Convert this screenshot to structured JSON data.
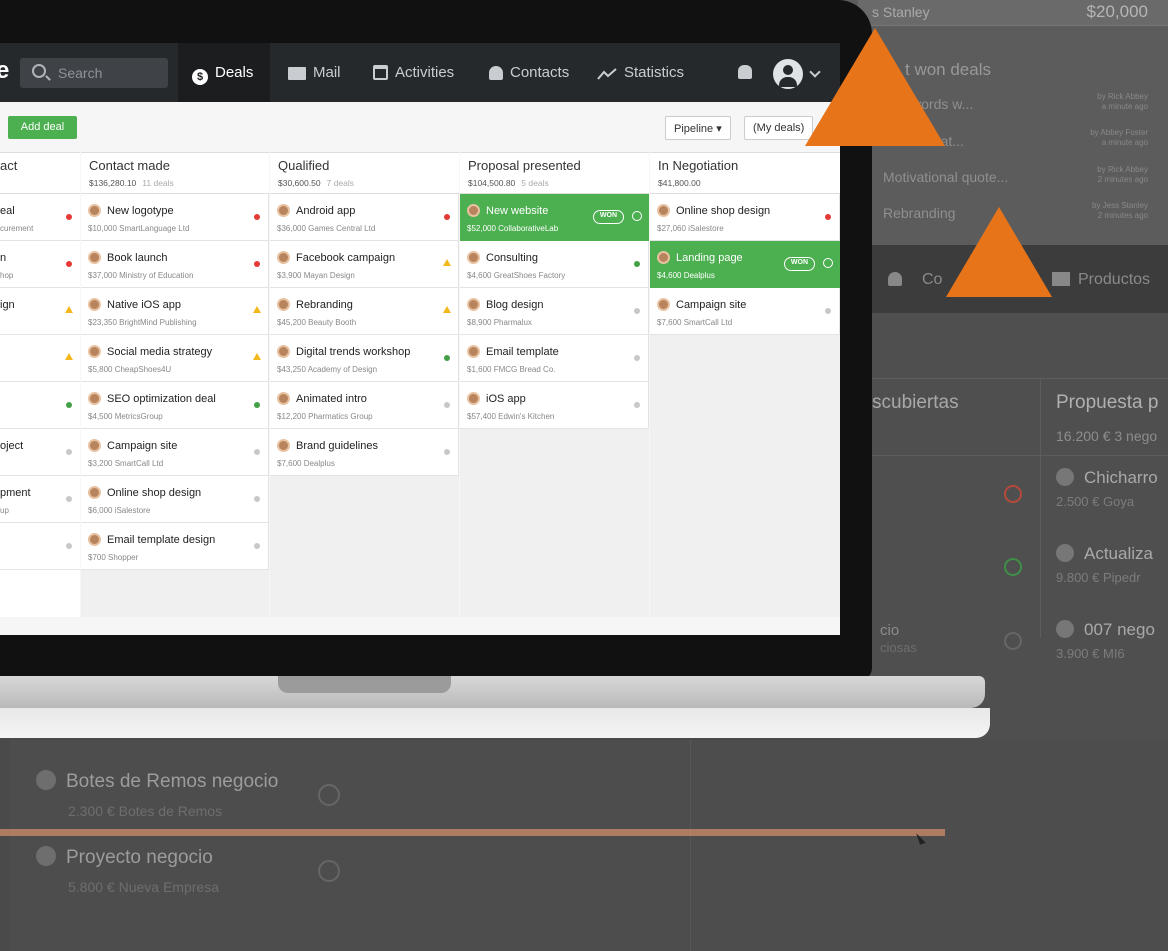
{
  "background": {
    "top_row": {
      "name": "s Stanley",
      "value": "$20,000"
    },
    "won_title": "t won deals",
    "won_items": [
      {
        "label": "e Adwords w...",
        "meta1": "by Rick Abbey",
        "meta2": "a minute ago"
      },
      {
        "label": "aunch strat...",
        "meta1": "by Abbey Foster",
        "meta2": "a minute ago"
      },
      {
        "label": "Motivational quote...",
        "meta1": "by Rick Abbey",
        "meta2": "2 minutes ago"
      },
      {
        "label": "Rebranding",
        "meta1": "by Jess Stanley",
        "meta2": "2 minutes ago"
      }
    ],
    "nav": {
      "contacts": "Co",
      "products": "Productos"
    },
    "stage_a": "scubiertas",
    "stage_b": {
      "title": "Propuesta p",
      "sub": "16.200 € 3 nego"
    },
    "cards": [
      {
        "title": "Chicharro",
        "sub": "2.500 €  Goya"
      },
      {
        "title": "Actualiza",
        "sub": "9.800 €  Pipedr"
      },
      {
        "title": "007 nego",
        "sub": "3.900 €  MI6"
      }
    ],
    "left_items": [
      {
        "title": "cio",
        "sub": "ciosas"
      }
    ],
    "bottom_items": [
      {
        "title": "Botes de Remos negocio",
        "sub": "2.300 €  Botes de Remos"
      },
      {
        "title": "Proyecto negocio",
        "sub": "5.800 €  Nueva Empresa"
      }
    ],
    "colors": {
      "orange": "#e8741a"
    }
  },
  "app": {
    "logo": "e",
    "search_placeholder": "Search",
    "nav": [
      {
        "label": "Deals",
        "icon": "dollar-icon",
        "active": true
      },
      {
        "label": "Mail",
        "icon": "mail-icon"
      },
      {
        "label": "Activities",
        "icon": "calendar-icon"
      },
      {
        "label": "Contacts",
        "icon": "person-icon"
      },
      {
        "label": "Statistics",
        "icon": "trend-icon"
      }
    ],
    "toolbar": {
      "add_deal": "Add deal",
      "pipeline": "Pipeline ▾",
      "filter": "(My deals)"
    },
    "left_stage": {
      "title": "act",
      "items": [
        {
          "t": "eal",
          "s": "curement"
        },
        {
          "t": "n",
          "s": "hop"
        },
        {
          "t": "ign",
          "s": ""
        },
        {
          "t": "",
          "s": ""
        },
        {
          "t": "",
          "s": ""
        },
        {
          "t": "oject",
          "s": ""
        },
        {
          "t": "pment",
          "s": "up"
        },
        {
          "t": "",
          "s": ""
        }
      ]
    },
    "stages": [
      {
        "title": "Contact made",
        "amount": "$136,280.10",
        "count": "11 deals",
        "deals": [
          {
            "title": "New logotype",
            "sub": "$10,000  SmartLanguage Ltd",
            "status": "red"
          },
          {
            "title": "Book launch",
            "sub": "$37,000  Ministry of Education",
            "status": "red"
          },
          {
            "title": "Native iOS app",
            "sub": "$23,350  BrightMind Publishing",
            "status": "yellow"
          },
          {
            "title": "Social media strategy",
            "sub": "$5,800  CheapShoes4U",
            "status": "yellow"
          },
          {
            "title": "SEO optimization deal",
            "sub": "$4,500  MetricsGroup",
            "status": "green"
          },
          {
            "title": "Campaign site",
            "sub": "$3,200  SmartCall Ltd",
            "status": "gray"
          },
          {
            "title": "Online shop design",
            "sub": "$6,000  iSalestore",
            "status": "gray"
          },
          {
            "title": "Email template design",
            "sub": "$700  Shopper",
            "status": "gray"
          }
        ]
      },
      {
        "title": "Qualified",
        "amount": "$30,600.50",
        "count": "7 deals",
        "deals": [
          {
            "title": "Android app",
            "sub": "$36,000  Games Central Ltd",
            "status": "red"
          },
          {
            "title": "Facebook campaign",
            "sub": "$3,900  Mayan Design",
            "status": "yellow"
          },
          {
            "title": "Rebranding",
            "sub": "$45,200  Beauty Booth",
            "status": "yellow"
          },
          {
            "title": "Digital trends workshop",
            "sub": "$43,250  Academy of Design",
            "status": "green"
          },
          {
            "title": "Animated intro",
            "sub": "$12,200  Pharmatics Group",
            "status": "gray"
          },
          {
            "title": "Brand guidelines",
            "sub": "$7,600  Dealplus",
            "status": "gray"
          }
        ]
      },
      {
        "title": "Proposal presented",
        "amount": "$104,500.80",
        "count": "5 deals",
        "deals": [
          {
            "title": "New website",
            "sub": "$52,000  CollaborativeLab",
            "status": "yellow",
            "won": true
          },
          {
            "title": "Consulting",
            "sub": "$4,600  GreatShoes Factory",
            "status": "green"
          },
          {
            "title": "Blog design",
            "sub": "$8,900  Pharmalux",
            "status": "gray"
          },
          {
            "title": "Email template",
            "sub": "$1,600  FMCG Bread Co.",
            "status": "gray"
          },
          {
            "title": "iOS app",
            "sub": "$57,400  Edwin's Kitchen",
            "status": "gray"
          }
        ]
      },
      {
        "title": "In Negotiation",
        "amount": "$41,800.00",
        "count": "",
        "deals": [
          {
            "title": "Online shop design",
            "sub": "$27,060  iSalestore",
            "status": "red"
          },
          {
            "title": "Landing page",
            "sub": "$4,600  Dealplus",
            "status": "none",
            "won": true
          },
          {
            "title": "Campaign site",
            "sub": "$7,600  SmartCall Ltd",
            "status": "gray"
          }
        ]
      }
    ],
    "won_label": "WON"
  }
}
